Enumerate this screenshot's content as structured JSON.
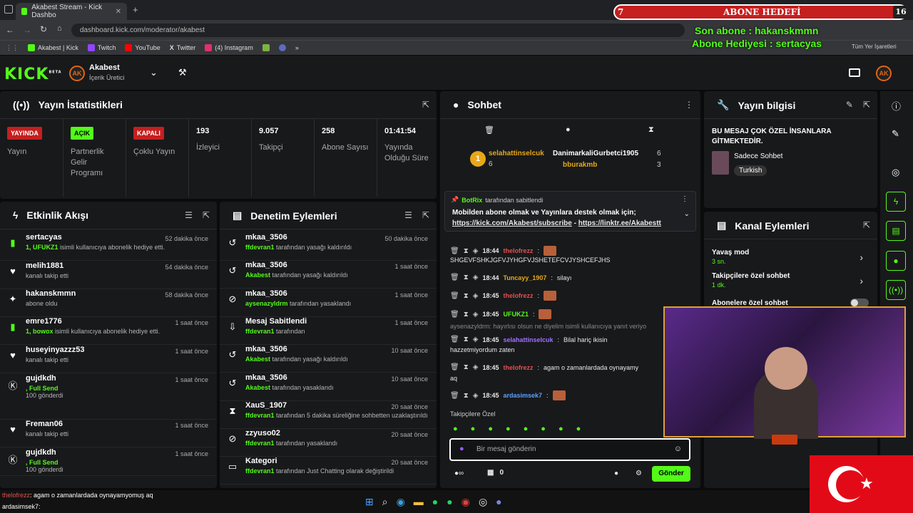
{
  "browser": {
    "tab_title": "Akabest Stream - Kick Dashbo",
    "url": "dashboard.kick.com/moderator/akabest",
    "bookmarks": [
      "Akabest | Kick",
      "Twitch",
      "YouTube",
      "Twitter",
      "(4) Instagram"
    ],
    "bookmarks_right": "Tüm Yer İşaretleri"
  },
  "overlay": {
    "goal_count_left": "7",
    "goal_title": "ABONE HEDEFİ",
    "goal_count_right": "16",
    "last_sub": "Son abone : hakanskmmn",
    "gift_sub": "Abone Hediyesi : sertacyas"
  },
  "header": {
    "logo": "KICK",
    "logo_beta": "BETA",
    "channel": "Akabest",
    "role": "İçerik Üretici"
  },
  "stats": {
    "title": "Yayın İstatistikleri",
    "items": [
      {
        "badge": "YAYINDA",
        "label": "Yayın"
      },
      {
        "badge": "AÇIK",
        "label": "Partnerlik Gelir Programı"
      },
      {
        "badge": "KAPALI",
        "label": "Çoklu Yayın"
      },
      {
        "value": "193",
        "label": "İzleyici"
      },
      {
        "value": "9.057",
        "label": "Takipçi"
      },
      {
        "value": "258",
        "label": "Abone Sayısı"
      },
      {
        "value": "01:41:54",
        "label": "Yayında Olduğu Süre"
      }
    ]
  },
  "activity": {
    "title": "Etkinlik Akışı",
    "rows": [
      {
        "name": "sertacyas",
        "time": "52 dakika önce",
        "sub_highlight": "1, UFUKZ1",
        "sub": " isimli kullanıcıya abonelik hediye etti."
      },
      {
        "name": "melih1881",
        "time": "54 dakika önce",
        "sub_highlight": "",
        "sub": "kanalı takip etti"
      },
      {
        "name": "hakanskmmn",
        "time": "58 dakika önce",
        "sub_highlight": "",
        "sub": "abone oldu"
      },
      {
        "name": "emre1776",
        "time": "1 saat önce",
        "sub_highlight": "1, bowox",
        "sub": " isimli kullanıcıya abonelik hediye etti."
      },
      {
        "name": "huseyinyazzz53",
        "time": "1 saat önce",
        "sub_highlight": "",
        "sub": "kanalı takip etti"
      },
      {
        "name": "gujdkdh",
        "time": "1 saat önce",
        "sub_highlight": ", Full Send",
        "sub": "100 gönderdi"
      },
      {
        "name": "Freman06",
        "time": "1 saat önce",
        "sub_highlight": "",
        "sub": "kanalı takip etti"
      },
      {
        "name": "gujdkdh",
        "time": "1 saat önce",
        "sub_highlight": ", Full Send",
        "sub": "100 gönderdi"
      }
    ]
  },
  "moderation": {
    "title": "Denetim Eylemleri",
    "rows": [
      {
        "name": "mkaa_3506",
        "time": "50 dakika önce",
        "actor": "ffdevran1",
        "sub": " tarafından yasağı kaldırıldı"
      },
      {
        "name": "mkaa_3506",
        "time": "1 saat önce",
        "actor": "Akabest",
        "sub": " tarafından yasağı kaldırıldı"
      },
      {
        "name": "mkaa_3506",
        "time": "1 saat önce",
        "actor": "aysenazyldrm",
        "sub": " tarafından yasaklandı"
      },
      {
        "name": "Mesaj Sabitlendi",
        "time": "1 saat önce",
        "actor": "ffdevran1",
        "sub": " tarafından"
      },
      {
        "name": "mkaa_3506",
        "time": "10 saat önce",
        "actor": "Akabest",
        "sub": " tarafından yasağı kaldırıldı"
      },
      {
        "name": "mkaa_3506",
        "time": "10 saat önce",
        "actor": "Akabest",
        "sub": " tarafından yasaklandı"
      },
      {
        "name": "XauS_1907",
        "time": "20 saat önce",
        "actor": "ffdevran1",
        "sub": " tarafından 5 dakika süreliğine sohbetten uzaklaştırıldı"
      },
      {
        "name": "zzyuso02",
        "time": "20 saat önce",
        "actor": "ffdevran1",
        "sub": " tarafından yasaklandı"
      },
      {
        "name": "Kategori",
        "time": "20 saat önce",
        "actor": "ffdevran1",
        "sub": " tarafından Just Chatting olarak değiştirildi"
      }
    ]
  },
  "chat": {
    "title": "Sohbet",
    "top_user": "selahattinselcuk",
    "top_user_count": "6",
    "top_rank": "1",
    "second_user": "DanimarkaliGurbetci1905",
    "second_count": "6",
    "third_user": "bburakmb",
    "third_count": "3",
    "pinned_by": "BotRix",
    "pinned_suffix": "tarafından sabitlendi",
    "pinned_text": "Mobilden abone olmak ve Yayınlara destek olmak için;",
    "pinned_link1": "https://kick.com/Akabest/subscribe",
    "pinned_sep": " - ",
    "pinned_link2": "https://linktr.ee/Akabestt",
    "messages": [
      {
        "time": "",
        "user": "",
        "text": "SHGEVFSHKJGFVJYHGFVJSHETEFCVJYSHCEFJHS"
      },
      {
        "time": "18:44",
        "user": "thelofrezz",
        "text": ""
      },
      {
        "time": "18:44",
        "user": "Tuncayy_1907",
        "text": " silayı"
      },
      {
        "time": "18:45",
        "user": "thelofrezz",
        "text": ""
      },
      {
        "time": "18:45",
        "user": "UFUKZ1",
        "text": ""
      },
      {
        "time": "",
        "user": "",
        "text": "aysenazyldrm: hayırlısı olsun ne diyelim isimli kullanıcıya yanıt veriyo"
      },
      {
        "time": "18:45",
        "user": "selahattinselcuk",
        "text": " Bilal hariç ikisin"
      },
      {
        "time": "",
        "user": "",
        "text": "hazzetmiyordum zaten"
      },
      {
        "time": "18:45",
        "user": "thelofrezz",
        "text": " agam o zamanlardada oynayamy"
      },
      {
        "time": "",
        "user": "",
        "text": "aq"
      },
      {
        "time": "18:45",
        "user": "ardasimsek7",
        "text": ""
      }
    ],
    "followers_only": "Takipçilere Özel",
    "input_placeholder": "Bir mesaj gönderin",
    "points": "0",
    "send": "Gönder"
  },
  "stream_info": {
    "title": "Yayın bilgisi",
    "message": "BU MESAJ ÇOK ÖZEL İNSANLARA GİTMEKTEDİR.",
    "stream_title": "Sadece Sohbet",
    "language": "Turkish"
  },
  "channel_actions": {
    "title": "Kanal Eylemleri",
    "items": [
      {
        "label": "Yavaş mod",
        "value": "3 sn."
      },
      {
        "label": "Takipçilere özel sohbet",
        "value": "1 dk."
      },
      {
        "label": "Abonelere özel sohbet",
        "value": ""
      }
    ]
  },
  "bottom_chat": [
    {
      "user": "thelofrezz",
      "text": ": agam o zamanlardada oynayamyomuş aq"
    },
    {
      "user": "ardasimsek7",
      "text": ":"
    }
  ],
  "colors": {
    "accent": "#53fc18",
    "panel": "#18191b",
    "bg": "#0b0b0c",
    "red": "#c51f1f"
  }
}
